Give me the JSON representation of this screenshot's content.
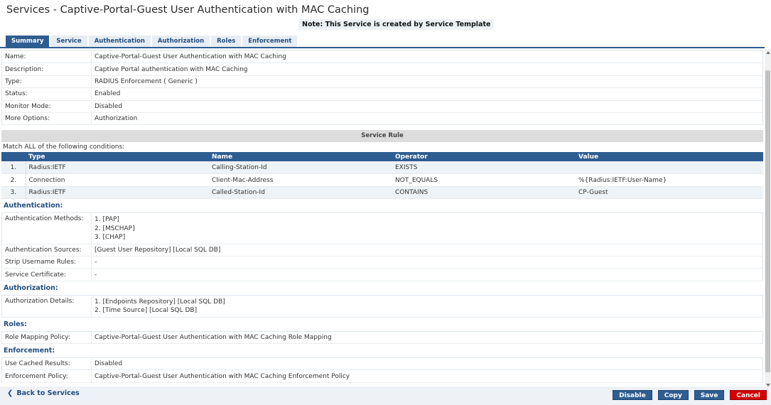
{
  "page": {
    "title": "Services - Captive-Portal-Guest User Authentication with MAC Caching",
    "notice": "Note: This Service is created by Service Template"
  },
  "tabs": [
    {
      "label": "Summary",
      "active": true
    },
    {
      "label": "Service"
    },
    {
      "label": "Authentication"
    },
    {
      "label": "Authorization"
    },
    {
      "label": "Roles"
    },
    {
      "label": "Enforcement"
    }
  ],
  "summary": [
    {
      "key": "Name:",
      "value": "Captive-Portal-Guest User Authentication with MAC Caching"
    },
    {
      "key": "Description:",
      "value": "Captive Portal authentication with MAC Caching"
    },
    {
      "key": "Type:",
      "value": "RADIUS Enforcement ( Generic )"
    },
    {
      "key": "Status:",
      "value": "Enabled"
    },
    {
      "key": "Monitor Mode:",
      "value": "Disabled"
    },
    {
      "key": "More Options:",
      "value": "Authorization"
    }
  ],
  "service_rule": {
    "header": "Service Rule",
    "match_text": "Match ALL of the following conditions:",
    "columns": [
      "Type",
      "Name",
      "Operator",
      "Value"
    ],
    "rows": [
      {
        "idx": "1.",
        "type": "Radius:IETF",
        "name": "Calling-Station-Id",
        "operator": "EXISTS",
        "value": ""
      },
      {
        "idx": "2.",
        "type": "Connection",
        "name": "Client-Mac-Address",
        "operator": "NOT_EQUALS",
        "value": "%{Radius:IETF:User-Name}"
      },
      {
        "idx": "3.",
        "type": "Radius:IETF",
        "name": "Called-Station-Id",
        "operator": "CONTAINS",
        "value": "CP-Guest"
      }
    ]
  },
  "authentication": {
    "title": "Authentication:",
    "methods_key": "Authentication Methods:",
    "methods": [
      "1. [PAP]",
      "2. [MSCHAP]",
      "3. [CHAP]"
    ],
    "sources_key": "Authentication Sources:",
    "sources": "[Guest User Repository] [Local SQL DB]",
    "strip_key": "Strip Username Rules:",
    "strip": "-",
    "cert_key": "Service Certificate:",
    "cert": "-"
  },
  "authorization": {
    "title": "Authorization:",
    "details_key": "Authorization Details:",
    "details": [
      "1. [Endpoints Repository] [Local SQL DB]",
      "2. [Time Source] [Local SQL DB]"
    ]
  },
  "roles": {
    "title": "Roles:",
    "policy_key": "Role Mapping Policy:",
    "policy": "Captive-Portal-Guest User Authentication with MAC Caching Role Mapping"
  },
  "enforcement": {
    "title": "Enforcement:",
    "cached_key": "Use Cached Results:",
    "cached": "Disabled",
    "policy_key": "Enforcement Policy:",
    "policy": "Captive-Portal-Guest User Authentication with MAC Caching Enforcement Policy"
  },
  "footer": {
    "back_label": "Back to Services",
    "disable_label": "Disable",
    "copy_label": "Copy",
    "save_label": "Save",
    "cancel_label": "Cancel"
  },
  "icons": {
    "back": "chevron-left-icon",
    "scroll_up": "arrow-up-icon",
    "scroll_down": "arrow-down-icon"
  },
  "colors": {
    "accent": "#2e5d91",
    "link": "#224e80",
    "cancel": "#d40000"
  }
}
